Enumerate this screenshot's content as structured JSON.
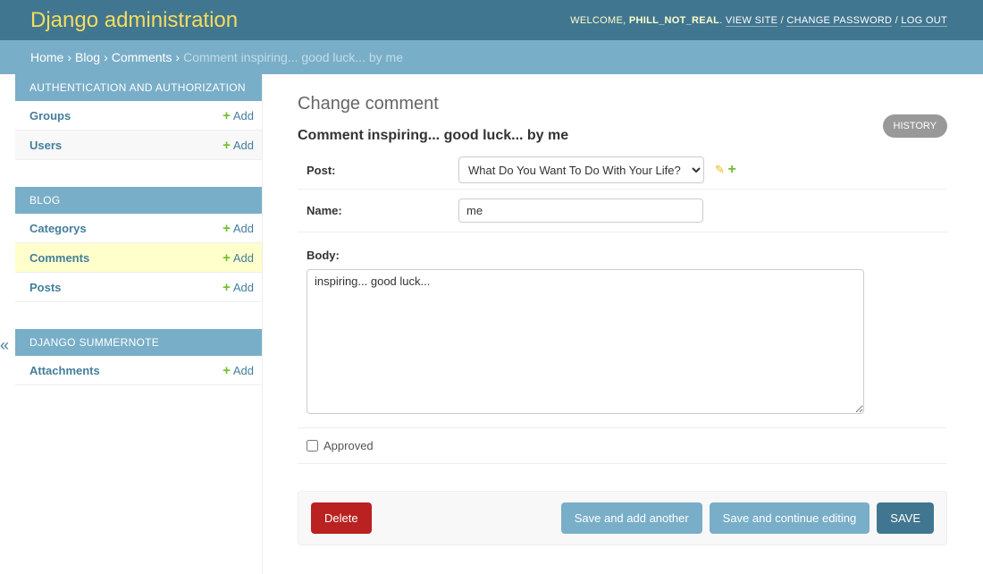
{
  "header": {
    "title": "Django administration",
    "welcome": "WELCOME,",
    "user": "PHILL_NOT_REAL",
    "view_site": "VIEW SITE",
    "change_password": "CHANGE PASSWORD",
    "logout": "LOG OUT"
  },
  "breadcrumbs": [
    "Home",
    "Blog",
    "Comments",
    "Comment inspiring... good luck... by me"
  ],
  "sidebar": {
    "add_label": "Add",
    "toggle": "«",
    "modules": [
      {
        "caption": "AUTHENTICATION AND AUTHORIZATION",
        "items": [
          "Groups",
          "Users"
        ]
      },
      {
        "caption": "BLOG",
        "items": [
          "Categorys",
          "Comments",
          "Posts"
        ]
      },
      {
        "caption": "DJANGO SUMMERNOTE",
        "items": [
          "Attachments"
        ]
      }
    ]
  },
  "main": {
    "title": "Change comment",
    "history": "HISTORY",
    "object_title": "Comment inspiring... good luck... by me",
    "post_label": "Post:",
    "post_value": "What Do You Want To Do With Your Life?",
    "name_label": "Name:",
    "name_value": "me",
    "body_label": "Body:",
    "body_value": "inspiring... good luck...",
    "approved_label": "Approved",
    "approved": false
  },
  "actions": {
    "delete": "Delete",
    "save_add": "Save and add another",
    "save_continue": "Save and continue editing",
    "save": "SAVE"
  },
  "colors": {
    "header": "#417690",
    "breadcrumbs": "#79aec8",
    "delete": "#ba2121",
    "save": "#417690",
    "secondary": "#79aec8"
  }
}
